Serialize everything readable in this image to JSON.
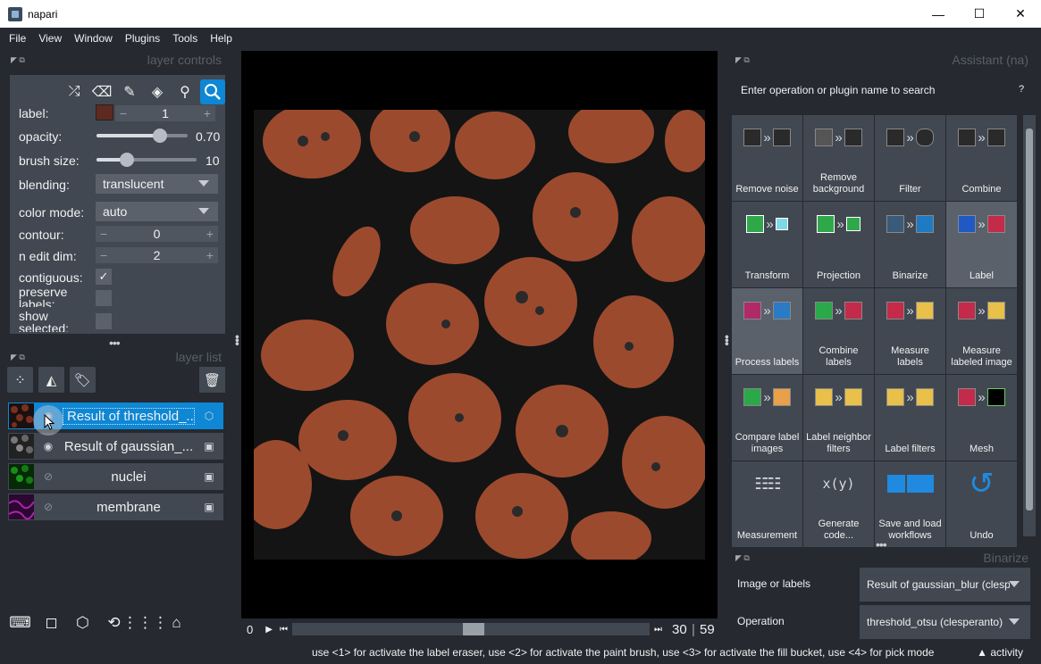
{
  "window": {
    "title": "napari",
    "min": "—",
    "max": "☐",
    "close": "✕"
  },
  "menu": [
    "File",
    "View",
    "Window",
    "Plugins",
    "Tools",
    "Help"
  ],
  "layer_controls": {
    "title": "layer controls",
    "label_lbl": "label:",
    "label_val": "1",
    "opacity_lbl": "opacity:",
    "opacity_val": "0.70",
    "opacity_frac": 0.7,
    "brush_lbl": "brush size:",
    "brush_val": "10",
    "brush_frac": 0.1,
    "blending_lbl": "blending:",
    "blending_val": "translucent",
    "colormode_lbl": "color mode:",
    "colormode_val": "auto",
    "contour_lbl": "contour:",
    "contour_val": "0",
    "nedit_lbl": "n edit dim:",
    "nedit_val": "2",
    "contiguous_lbl": "contiguous:",
    "preserve_lbl": "preserve labels:",
    "show_lbl": "show selected:"
  },
  "layer_list": {
    "title": "layer list",
    "layers": [
      {
        "name": "Result of threshold_...",
        "selected": true
      },
      {
        "name": "Result of gaussian_...",
        "selected": false
      },
      {
        "name": "nuclei",
        "selected": false
      },
      {
        "name": "membrane",
        "selected": false
      }
    ]
  },
  "dims": {
    "start": "0",
    "current": "30",
    "total": "59"
  },
  "assistant": {
    "title": "Assistant (na)",
    "search_placeholder": "Enter operation or plugin name to search",
    "help": "?",
    "tiles": [
      "Remove noise",
      "Remove background",
      "Filter",
      "Combine",
      "Transform",
      "Projection",
      "Binarize",
      "Label",
      "Process labels",
      "Combine labels",
      "Measure labels",
      "Measure labeled image",
      "Compare label images",
      "Label neighbor filters",
      "Label filters",
      "Mesh",
      "Measurement",
      "Generate code...",
      "Save and load workflows",
      "Undo"
    ]
  },
  "binarize": {
    "title": "Binarize",
    "image_lbl": "Image or labels",
    "image_val": "Result of gaussian_blur (clespe",
    "op_lbl": "Operation",
    "op_val": "threshold_otsu (clesperanto)"
  },
  "status": "use <1> for activate the label eraser, use <2> for activate the paint brush, use <3> for activate the fill bucket, use <4> for pick mode",
  "activity": "activity"
}
